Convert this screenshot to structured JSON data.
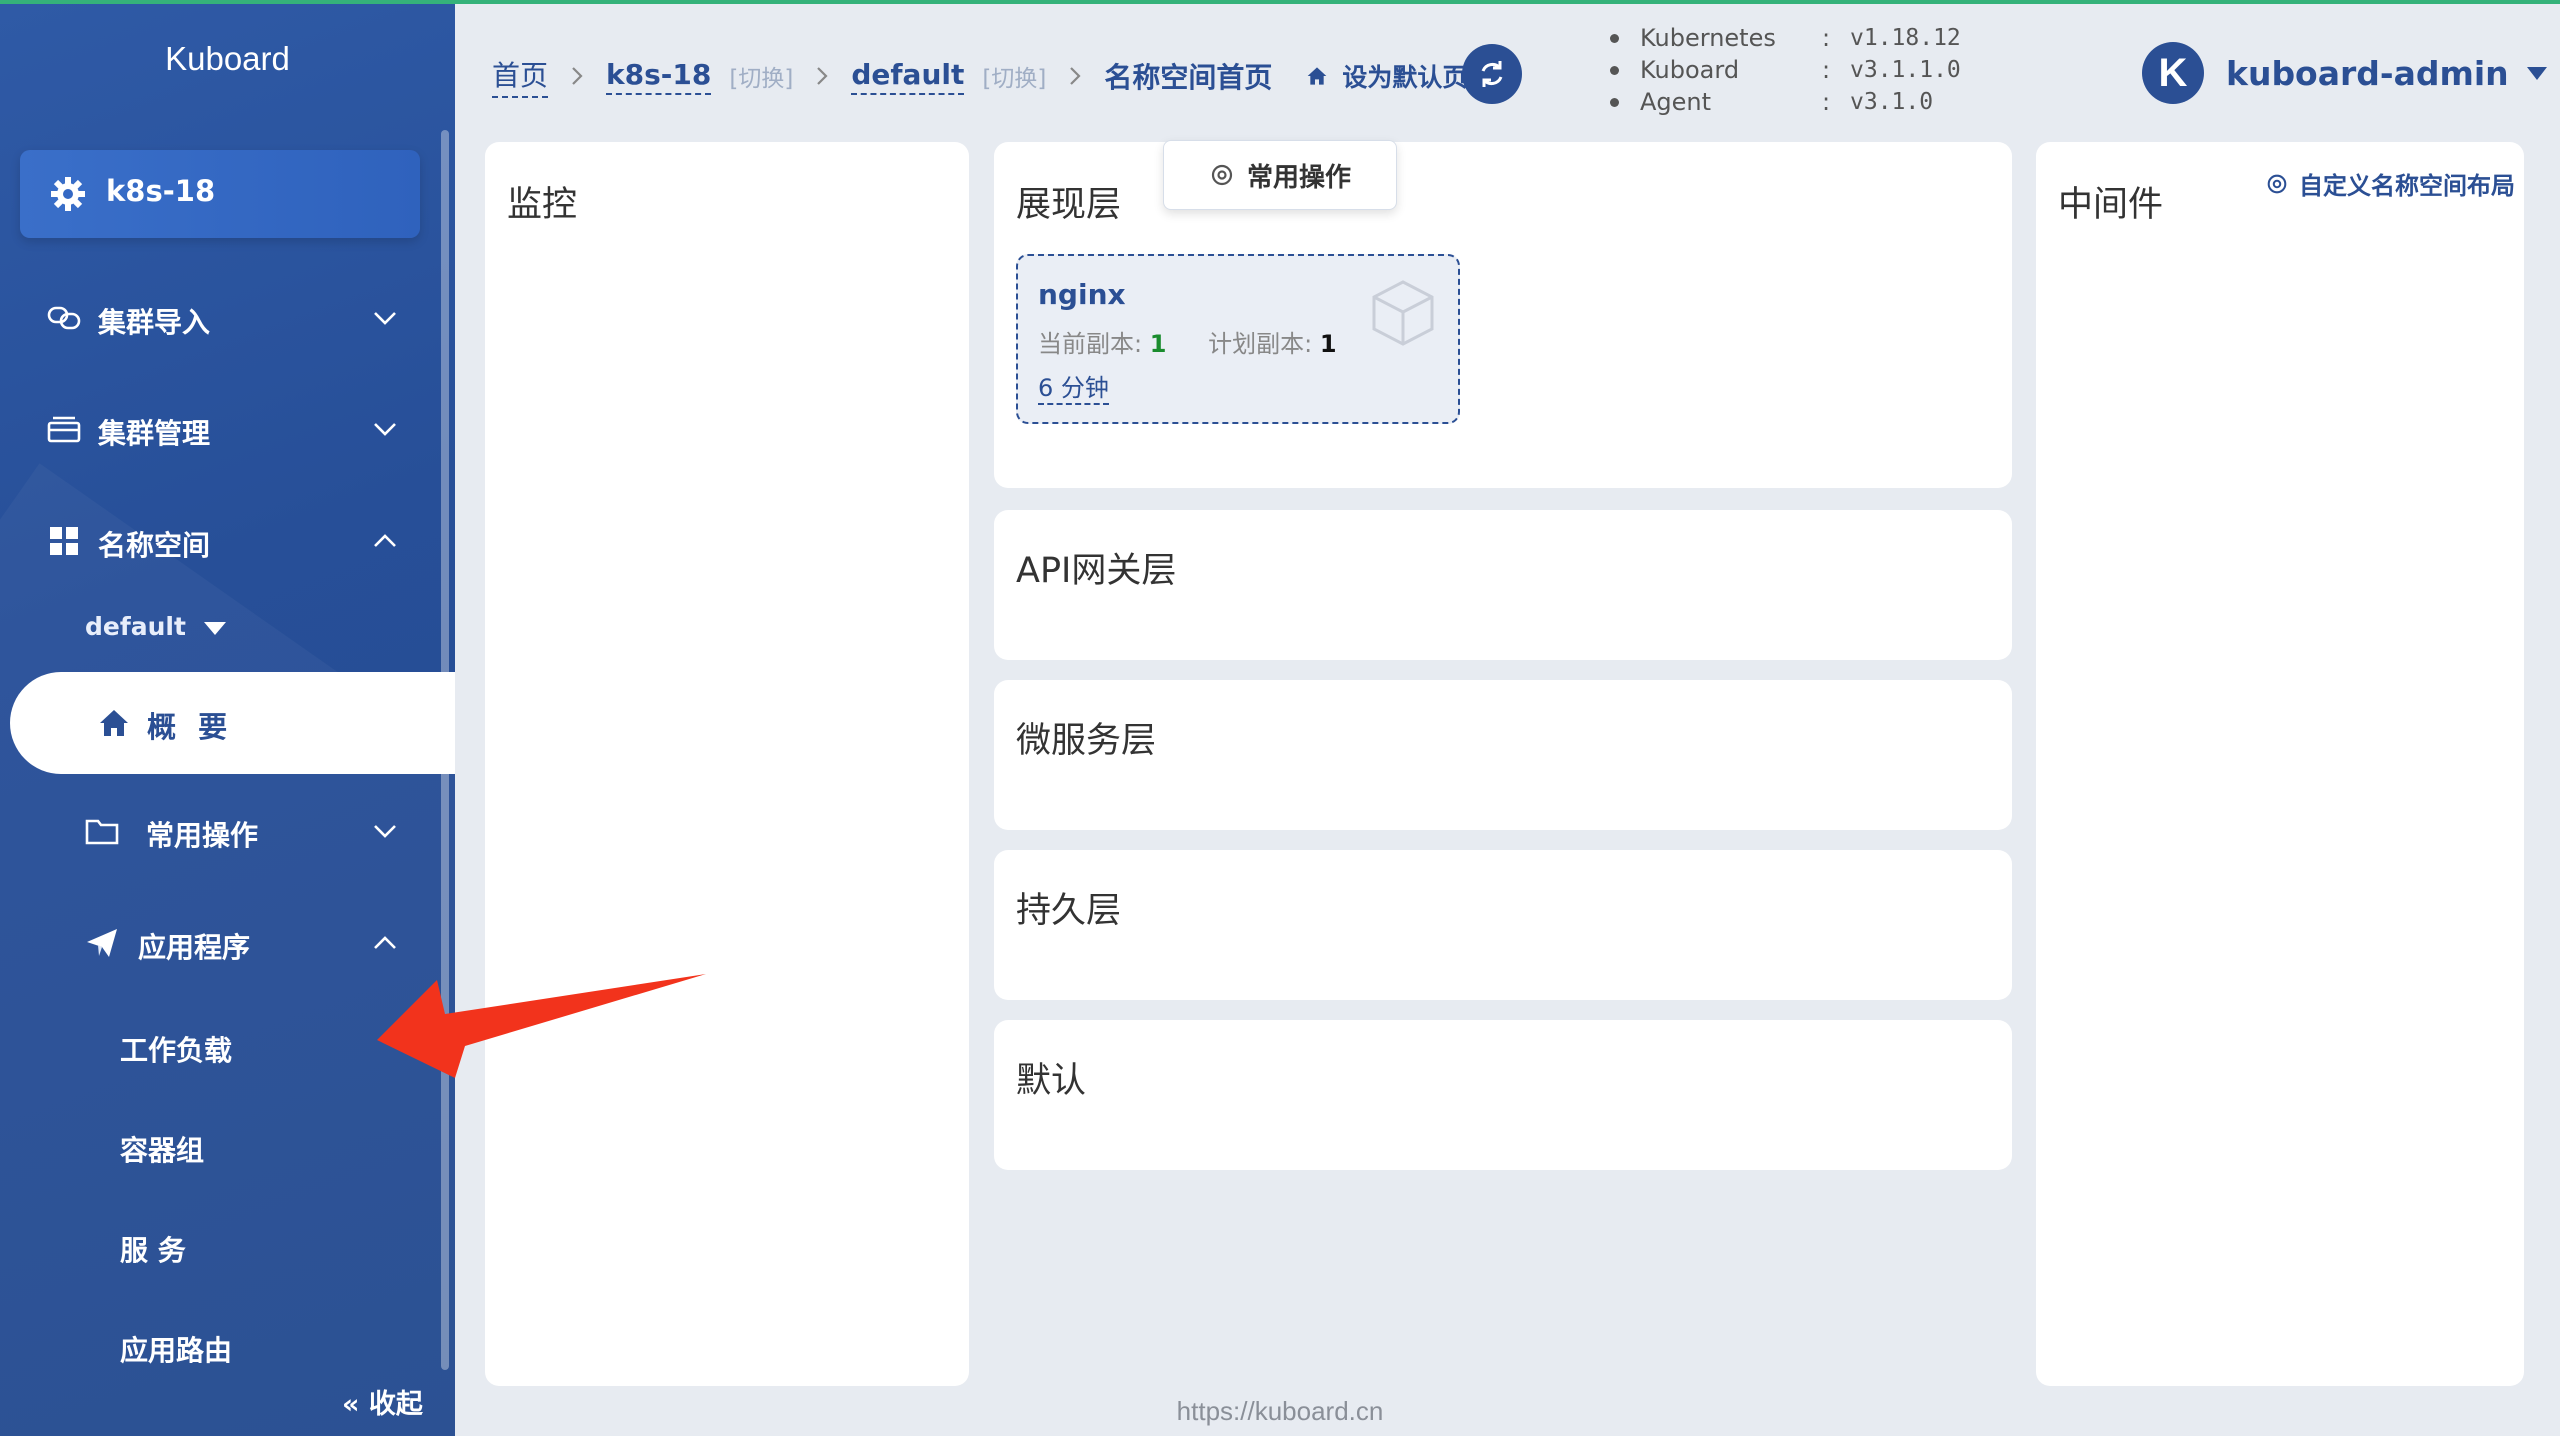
{
  "colors": {
    "sidebar": "#2a539c",
    "accent": "#2b4f94",
    "green": "#1a8c2e",
    "arrow": "#f2331c",
    "background": "#e7ebf1"
  },
  "sidebar": {
    "brand": "Kuboard",
    "cluster": {
      "name": "k8s-18",
      "icon": "gear-icon"
    },
    "items": [
      {
        "label": "集群导入",
        "icon": "link-icon",
        "state": "collapsed"
      },
      {
        "label": "集群管理",
        "icon": "server-icon",
        "state": "collapsed"
      },
      {
        "label": "名称空间",
        "icon": "grid-icon",
        "state": "expanded"
      }
    ],
    "namespace_select": "default",
    "active_item": "概 要",
    "common_ops": "常用操作",
    "applications": "应用程序",
    "sub_items": [
      "工作负载",
      "容器组",
      "服 务",
      "应用路由"
    ],
    "collapse": "收起"
  },
  "header": {
    "breadcrumb": {
      "home": "首页",
      "cluster": "k8s-18",
      "cluster_switch": "[切换]",
      "namespace": "default",
      "namespace_switch": "[切换]",
      "current": "名称空间首页"
    },
    "set_default": "设为默认页",
    "versions": [
      {
        "name": "Kubernetes",
        "sep": ":",
        "value": "v1.18.12"
      },
      {
        "name": "Kuboard",
        "sep": ":",
        "value": "v3.1.1.0"
      },
      {
        "name": "Agent",
        "sep": ":",
        "value": "v3.1.0"
      }
    ],
    "user": {
      "initial": "K",
      "name": "kuboard-admin"
    }
  },
  "main": {
    "monitor_title": "监控",
    "common_ops_button": "常用操作",
    "layers": [
      "展现层",
      "API网关层",
      "微服务层",
      "持久层",
      "默认"
    ],
    "middleware_title": "中间件",
    "custom_layout": "自定义名称空间布局",
    "app_card": {
      "name": "nginx",
      "current_label": "当前副本:",
      "current_value": "1",
      "planned_label": "计划副本:",
      "planned_value": "1",
      "age": "6 分钟"
    }
  },
  "footer": "https://kuboard.cn"
}
